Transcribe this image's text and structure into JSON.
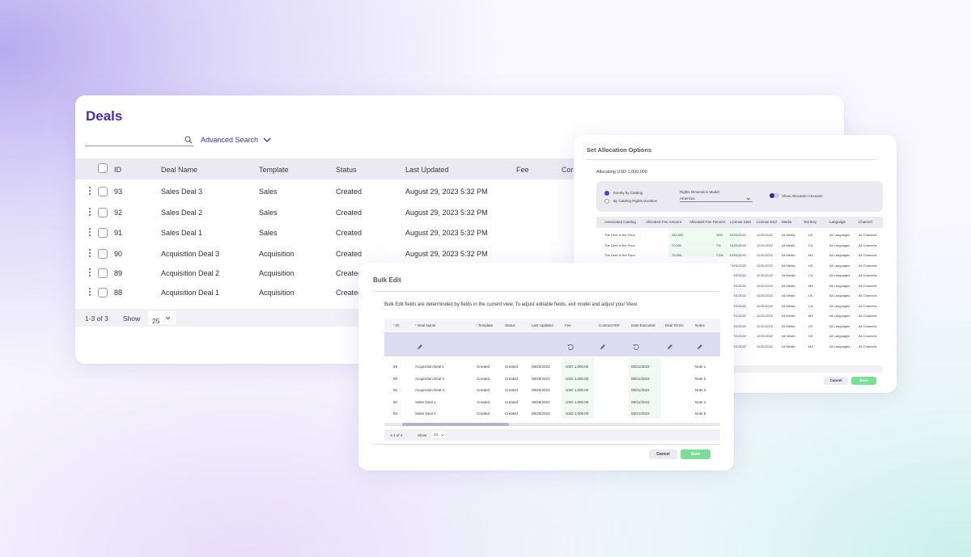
{
  "deals": {
    "title": "Deals",
    "search_placeholder": "",
    "advanced_search": "Advanced Search",
    "columns": [
      "ID",
      "Deal Name",
      "Template",
      "Status",
      "Last Updated",
      "Fee",
      "Cor"
    ],
    "rows": [
      {
        "id": "93",
        "name": "Sales Deal 3",
        "template": "Sales",
        "status": "Created",
        "updated": "August 29, 2023 5:32 PM"
      },
      {
        "id": "92",
        "name": "Sales Deal 2",
        "template": "Sales",
        "status": "Created",
        "updated": "August 29, 2023 5:32 PM"
      },
      {
        "id": "91",
        "name": "Sales Deal 1",
        "template": "Sales",
        "status": "Created",
        "updated": "August 29, 2023 5:32 PM"
      },
      {
        "id": "90",
        "name": "Acquisition Deal 3",
        "template": "Acquisition",
        "status": "Created",
        "updated": "August 29, 2023 5:32 PM"
      },
      {
        "id": "89",
        "name": "Acquisition Deal 2",
        "template": "Acquisition",
        "status": "Created",
        "updated": ""
      },
      {
        "id": "88",
        "name": "Acquisition Deal 1",
        "template": "Acquisition",
        "status": "Created",
        "updated": ""
      }
    ],
    "footer": {
      "count": "1-3 of 3",
      "show_label": "Show",
      "page_size": "25"
    }
  },
  "allocation": {
    "title": "Set Allocation Options",
    "allocating": "Allocating USD 1,000,000",
    "option_even": "Evenly by Catalog",
    "option_duration": "By Catalog Rights Duration",
    "rights_model_label": "Rights Dimension Model",
    "rights_model_value": "Americas",
    "toggle_label": "Show Allocation Amounts",
    "columns": [
      "Associated Catalog",
      "Allocated Fee Amount",
      "Allocated Fee Percent",
      "License Start",
      "License End",
      "Media",
      "Territory",
      "Language",
      "Channel"
    ],
    "rows": [
      {
        "catalog": "The Deer in the Floor",
        "amount": "150,000",
        "percent": "15%",
        "start": "01/01/2022",
        "end": "12/31/2022",
        "media": "All Media",
        "territory": "US",
        "language": "All Languages",
        "channel": "All Channels"
      },
      {
        "catalog": "The Deer in the Floor",
        "amount": "70,000",
        "percent": "7%",
        "start": "01/01/2022",
        "end": "12/31/2022",
        "media": "All Media",
        "territory": "CA",
        "language": "All Languages",
        "channel": "All Channels"
      },
      {
        "catalog": "The Deer in the Floor",
        "amount": "70,000",
        "percent": "7.5%",
        "start": "01/01/2022",
        "end": "12/31/2022",
        "media": "All Media",
        "territory": "MX",
        "language": "All Languages",
        "channel": "All Channels"
      },
      {
        "catalog": "",
        "amount": "",
        "percent": "",
        "start": "01/01/2022",
        "end": "12/31/2022",
        "media": "All Media",
        "territory": "US",
        "language": "All Languages",
        "channel": "All Channels"
      },
      {
        "catalog": "",
        "amount": "",
        "percent": "",
        "start": "01/01/2022",
        "end": "12/31/2022",
        "media": "All Media",
        "territory": "CA",
        "language": "All Languages",
        "channel": "All Channels"
      },
      {
        "catalog": "",
        "amount": "",
        "percent": "",
        "start": "01/01/2022",
        "end": "12/31/2022",
        "media": "All Media",
        "territory": "MX",
        "language": "All Languages",
        "channel": "All Channels"
      },
      {
        "catalog": "",
        "amount": "",
        "percent": "",
        "start": "01/01/2022",
        "end": "12/31/2022",
        "media": "All Media",
        "territory": "US",
        "language": "All Languages",
        "channel": "All Channels"
      },
      {
        "catalog": "",
        "amount": "",
        "percent": "",
        "start": "01/01/2022",
        "end": "12/31/2022",
        "media": "All Media",
        "territory": "CA",
        "language": "All Languages",
        "channel": "All Channels"
      },
      {
        "catalog": "",
        "amount": "",
        "percent": "",
        "start": "01/01/2022",
        "end": "12/31/2022",
        "media": "All Media",
        "territory": "MX",
        "language": "All Languages",
        "channel": "All Channels"
      },
      {
        "catalog": "",
        "amount": "",
        "percent": "",
        "start": "01/01/2022",
        "end": "12/31/2022",
        "media": "All Media",
        "territory": "US",
        "language": "All Languages",
        "channel": "All Channels"
      },
      {
        "catalog": "",
        "amount": "",
        "percent": "",
        "start": "01/01/2022",
        "end": "12/31/2022",
        "media": "All Media",
        "territory": "CA",
        "language": "All Languages",
        "channel": "All Channels"
      },
      {
        "catalog": "",
        "amount": "",
        "percent": "",
        "start": "01/01/2022",
        "end": "12/31/2022",
        "media": "All Media",
        "territory": "MX",
        "language": "All Languages",
        "channel": "All Channels"
      }
    ],
    "cancel": "Cancel",
    "save": "Save"
  },
  "bulk": {
    "title": "Bulk Edit",
    "description": "Bulk Edit fields are determinded by fields in the current view. To adjust editable fields, exit model and adjust your View.",
    "columns": [
      "ID",
      "Deal Name",
      "Template",
      "Status",
      "Last Updated",
      "Fee",
      "Contract ID#",
      "Date Executed",
      "Deal Terms",
      "Notes"
    ],
    "rows": [
      {
        "id": "89",
        "name": "Acquisition Deal 1",
        "template": "Created",
        "status": "Created",
        "updated": "08/29/2023",
        "fee": "USD 1,000.00",
        "executed": "08/21/2023",
        "notes": "Note 1"
      },
      {
        "id": "90",
        "name": "Acquisition Deal 2",
        "template": "Created",
        "status": "Created",
        "updated": "08/29/2023",
        "fee": "USD 1,000.00",
        "executed": "08/21/2023",
        "notes": "Note 2"
      },
      {
        "id": "91",
        "name": "Acquisition Deal 3",
        "template": "Created",
        "status": "Created",
        "updated": "08/29/2023",
        "fee": "USD 1,000.00",
        "executed": "08/21/2023",
        "notes": "Note 3"
      },
      {
        "id": "92",
        "name": "Sales Deal 1",
        "template": "Created",
        "status": "Created",
        "updated": "08/29/2023",
        "fee": "USD 1,000.00",
        "executed": "08/21/2023",
        "notes": "Note 4"
      },
      {
        "id": "93",
        "name": "Sales Deal 2",
        "template": "Created",
        "status": "Created",
        "updated": "08/29/2023",
        "fee": "USD 1,000.00",
        "executed": "08/21/2023",
        "notes": "Note 5"
      }
    ],
    "footer": {
      "count": "1-4 of 4",
      "show_label": "Show",
      "page_size": "10"
    },
    "cancel": "Cancel",
    "save": "Save"
  },
  "colors": {
    "brand": "#4b2ea0",
    "save_green": "#7ddc97",
    "row_highlight": "#dedcf3"
  }
}
